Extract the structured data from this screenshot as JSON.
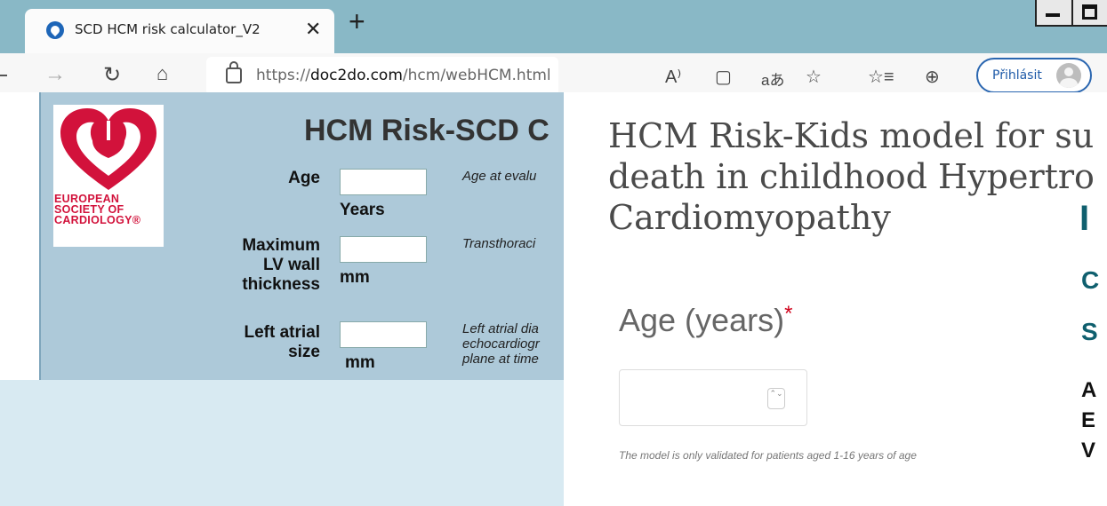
{
  "browser": {
    "tab_title": "SCD HCM risk calculator_V2",
    "tab_close": "✕",
    "new_tab": "+",
    "url_prefix": "https://",
    "url_domain": "doc2do.com",
    "url_path": "/hcm/webHCM.html",
    "signin_label": "Přihlásit",
    "icons": {
      "forward": "→",
      "refresh": "↻",
      "home": "⌂",
      "read_aloud": "A⁾",
      "immersive": "▢",
      "translate": "aあ",
      "add_favorite": "☆",
      "favorites": "☆≡",
      "collections": "⊕"
    }
  },
  "esc_calculator": {
    "logo_lines": [
      "EUROPEAN",
      "SOCIETY OF",
      "CARDIOLOGY®"
    ],
    "title": "HCM Risk-SCD C",
    "fields": [
      {
        "label": "Age",
        "unit": "Years",
        "description": "Age at evalu"
      },
      {
        "label": "Maximum LV wall thickness",
        "unit": "mm",
        "description": "Transthoraci"
      },
      {
        "label": "Left atrial size",
        "unit": "mm",
        "description_lines": [
          "Left atrial dia",
          "echocardiogr",
          "plane at time"
        ]
      }
    ]
  },
  "risk_kids": {
    "title_lines": [
      "HCM Risk-Kids model for su",
      "death in childhood Hypertro",
      "Cardiomyopathy"
    ],
    "age_label": "Age (years)",
    "required_marker": "*",
    "spinner": "⌃⌄",
    "age_note": "The model is only validated for patients aged 1-16 years of age",
    "side_fragments": {
      "big": "I",
      "c": "C",
      "s": "S",
      "lines": [
        "A",
        "E",
        "V"
      ]
    }
  },
  "colors": {
    "tabbar": "#89b8c6",
    "esc_red": "#d2123b",
    "calc_panel": "#adc9d9",
    "signin_border": "#2a66b0",
    "teal": "#0f5f6e"
  }
}
